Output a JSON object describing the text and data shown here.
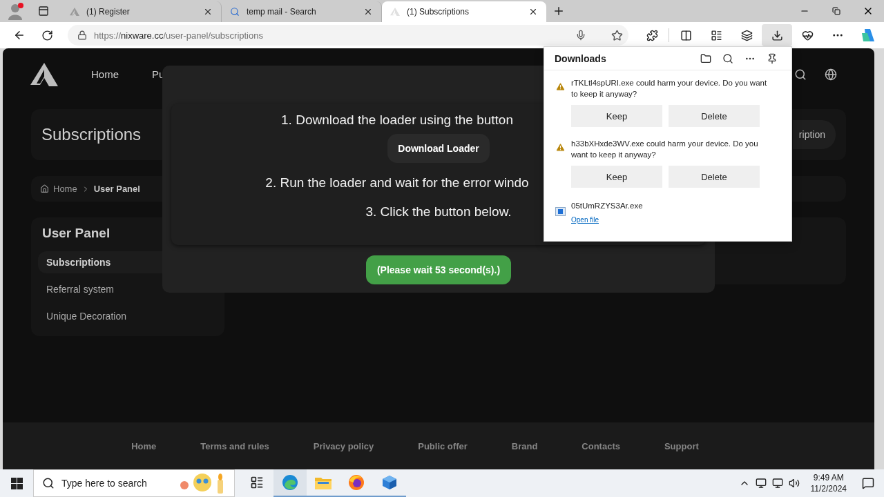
{
  "browser": {
    "tabs": [
      {
        "title": "(1) Register",
        "selected": false
      },
      {
        "title": "temp mail - Search",
        "selected": false
      },
      {
        "title": "(1) Subscriptions",
        "selected": true
      }
    ],
    "address": {
      "scheme": "https://",
      "host": "nixware.cc",
      "path": "/user-panel/subscriptions"
    },
    "downloads_button": {
      "selected": true
    }
  },
  "site": {
    "nav": [
      {
        "label": "Home"
      },
      {
        "label": "Pu"
      }
    ],
    "page_title": "Subscriptions",
    "header_button": "ription",
    "breadcrumb": [
      {
        "label": "Home",
        "current": false
      },
      {
        "label": "User Panel",
        "current": true
      }
    ],
    "sidebar": {
      "title": "User Panel",
      "items": [
        {
          "label": "Subscriptions",
          "selected": true
        },
        {
          "label": "Referral system",
          "selected": false
        },
        {
          "label": "Unique Decoration",
          "selected": false
        }
      ]
    },
    "footer_links": [
      "Home",
      "Terms and rules",
      "Privacy policy",
      "Public offer",
      "Brand",
      "Contacts",
      "Support"
    ]
  },
  "modal": {
    "steps": [
      "1. Download the loader using the button",
      "2. Run the loader and wait for the error windo",
      "3. Click the button below."
    ],
    "download_button": "Download Loader",
    "wait_button": "(Please wait 53 second(s).)"
  },
  "downloads_panel": {
    "title": "Downloads",
    "items": [
      {
        "kind": "warning",
        "message": "rTKLtl4spURI.exe could harm your device. Do you want to keep it anyway?",
        "keep": "Keep",
        "delete": "Delete"
      },
      {
        "kind": "warning",
        "message": "h33bXHxde3WV.exe could harm your device. Do you want to keep it anyway?",
        "keep": "Keep",
        "delete": "Delete"
      },
      {
        "kind": "file",
        "file_name": "05tUmRZYS3Ar.exe",
        "link": "Open file"
      }
    ]
  },
  "taskbar": {
    "search_placeholder": "Type here to search",
    "time": "9:49 AM",
    "date": "11/2/2024"
  }
}
